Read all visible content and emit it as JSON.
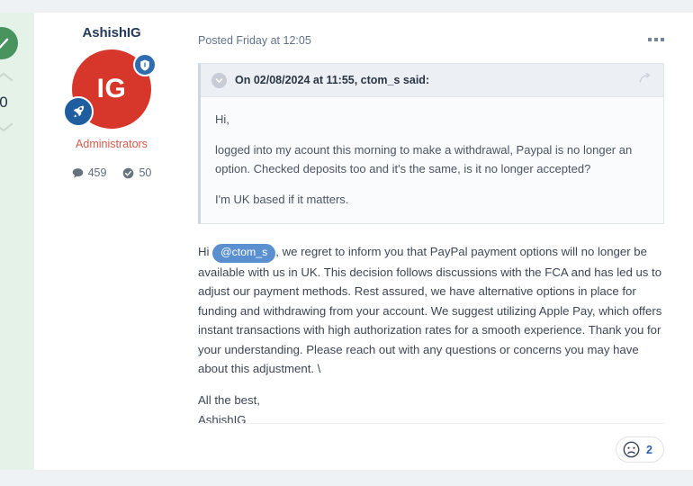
{
  "vote": {
    "solved_icon": "check-circle-icon",
    "up_icon": "chevron-up-icon",
    "down_icon": "chevron-down-icon",
    "count": "0"
  },
  "author": {
    "name": "AshishIG",
    "avatar_initials": "IG",
    "avatar_color": "#d6372a",
    "rank": "Administrators",
    "rank_color": "#d6594a",
    "shield_badge_icon": "shield-badge-icon",
    "rocket_badge_icon": "rocket-badge-icon",
    "stats": [
      {
        "icon": "comment-icon",
        "value": "459"
      },
      {
        "icon": "check-circle-icon",
        "value": "50"
      }
    ]
  },
  "post": {
    "posted_on": "Posted Friday at 12:05",
    "menu_icon": "ellipsis-icon"
  },
  "quote": {
    "collapse_icon": "chevron-down-circle-icon",
    "jump_icon": "reply-arrow-icon",
    "citation": "On 02/08/2024 at 11:55, ctom_s said:",
    "paragraphs": [
      "Hi,",
      "logged into my acount this morning to make a withdrawal, Paypal is no longer an option. Checked deposits too and it's the same, is it no longer accepted?",
      "I'm UK based if it matters."
    ]
  },
  "body": {
    "greeting_prefix": "Hi ",
    "mention": "@ctom_s",
    "main_text": ", we regret to inform you that PayPal payment options will no longer be available with us in UK. This decision follows discussions with the FCA and has led us to adjust our payment methods. Rest assured, we have alternative options in place for funding and withdrawing from your account. We suggest utilizing Apple Pay, which offers instant transactions with high authorization rates for a smooth experience. Thank you for your understanding. Please reach out with any questions or concerns you may have about this adjustment. \\",
    "signoff": "All the best,",
    "signature_name": "AshishIG"
  },
  "reactions": [
    {
      "icon": "sad-face-icon",
      "count": "2"
    }
  ]
}
